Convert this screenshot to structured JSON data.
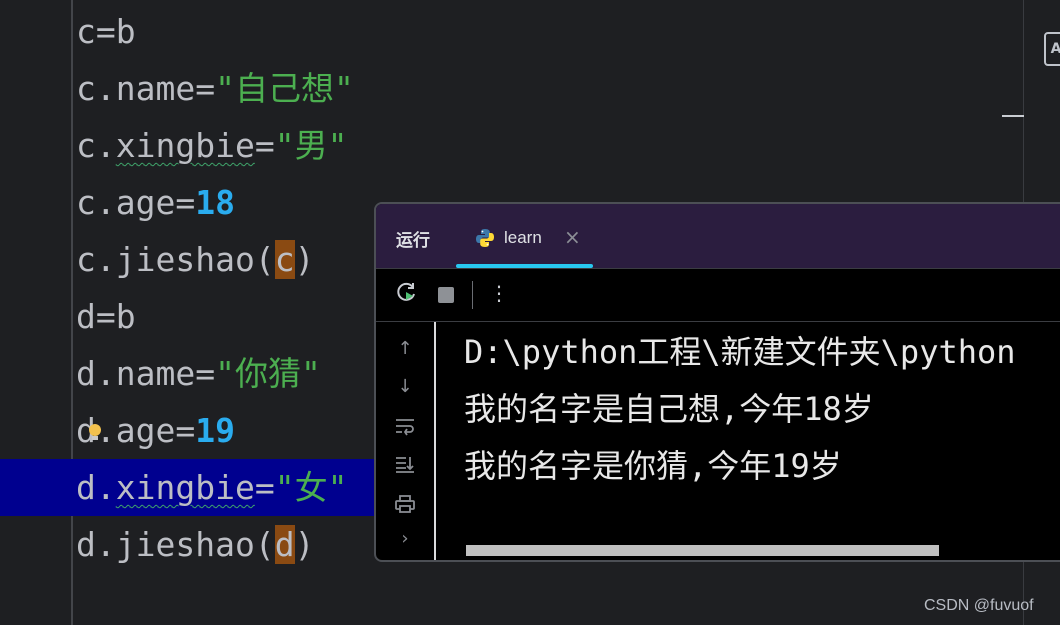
{
  "editor": {
    "lines": [
      {
        "parts": [
          "c=b"
        ]
      },
      {
        "parts": [
          "c.name=",
          "\"自己想\""
        ]
      },
      {
        "parts": [
          "c.",
          "xingbie",
          "=",
          "\"男\""
        ]
      },
      {
        "parts": [
          "c.age=",
          "18"
        ]
      },
      {
        "parts": [
          "c.jieshao(",
          "c",
          ")"
        ]
      },
      {
        "parts": [
          "d=b"
        ]
      },
      {
        "parts": [
          "d.name=",
          "\"你猜\""
        ]
      },
      {
        "parts": [
          "d.age=",
          "19"
        ]
      },
      {
        "parts": [
          "d.",
          "xingbie",
          "=",
          "\"女\""
        ]
      },
      {
        "parts": [
          "d.jieshao(",
          "d",
          ")"
        ]
      }
    ],
    "side_icon": "A"
  },
  "run_panel": {
    "title": "运行",
    "tab_label": "learn",
    "tab_icon": "python-icon",
    "close_glyph": "×",
    "output_lines": [
      "D:\\python工程\\新建文件夹\\python",
      "我的名字是自己想,今年18岁",
      "我的名字是你猜,今年19岁"
    ]
  },
  "watermark": "CSDN @fuvuof",
  "colors": {
    "editor_bg": "#1e1f22",
    "string": "#4caf50",
    "number": "#2aacef",
    "highlight_line": "#00008f",
    "panel_header": "#2b1d3f",
    "tab_accent": "#28c8f0"
  }
}
